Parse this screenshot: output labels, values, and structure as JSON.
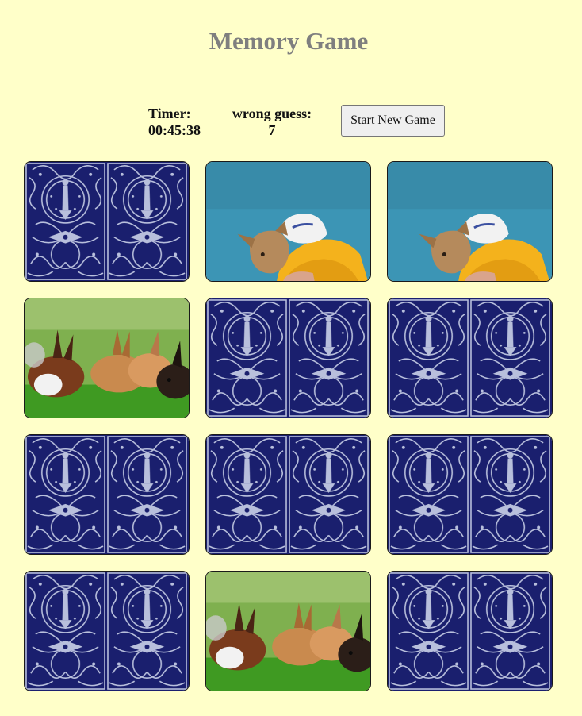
{
  "title": "Memory Game",
  "timer": {
    "label": "Timer:",
    "value": "00:45:38"
  },
  "wrong_guess": {
    "label": "wrong guess:",
    "value": "7"
  },
  "start_button_label": "Start New Game",
  "colors": {
    "background": "#ffffc9",
    "title": "#7f7f7f",
    "card_back": "#1a1f6e",
    "card_back_pattern": "#b8bfdc"
  },
  "board": {
    "columns": 3,
    "rows": 4,
    "cards": [
      {
        "state": "face-down",
        "image": "card-back"
      },
      {
        "state": "face-up",
        "image": "dog-in-yellow-hoodie"
      },
      {
        "state": "face-up",
        "image": "dog-in-yellow-hoodie"
      },
      {
        "state": "face-up",
        "image": "rabbits-on-grass"
      },
      {
        "state": "face-down",
        "image": "card-back"
      },
      {
        "state": "face-down",
        "image": "card-back"
      },
      {
        "state": "face-down",
        "image": "card-back"
      },
      {
        "state": "face-down",
        "image": "card-back"
      },
      {
        "state": "face-down",
        "image": "card-back"
      },
      {
        "state": "face-down",
        "image": "card-back"
      },
      {
        "state": "face-up",
        "image": "rabbits-on-grass"
      },
      {
        "state": "face-down",
        "image": "card-back"
      }
    ]
  }
}
